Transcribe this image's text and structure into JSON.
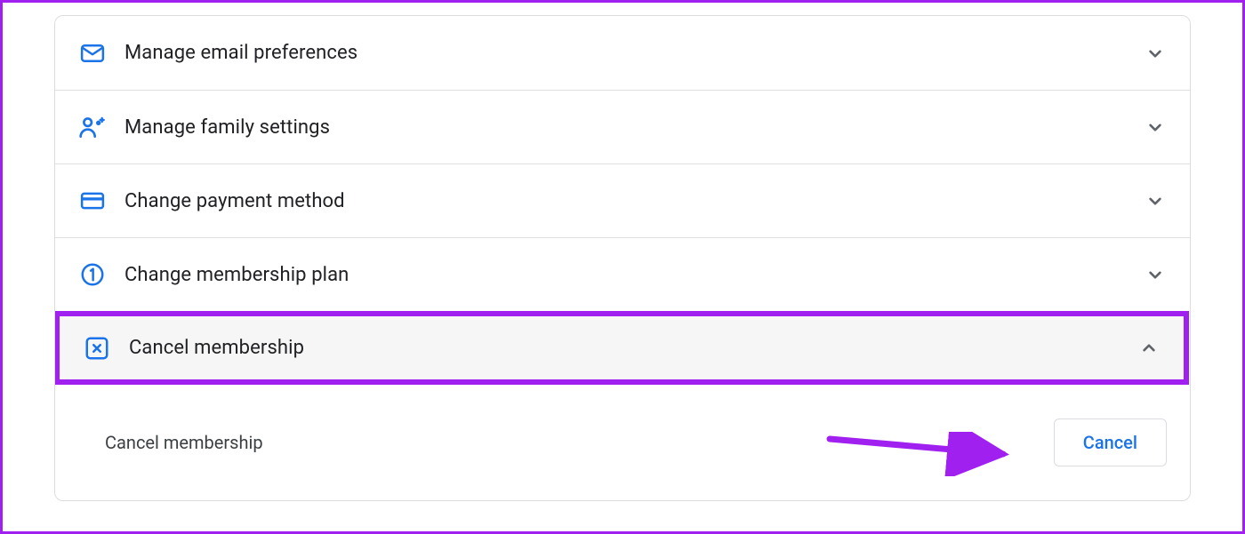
{
  "colors": {
    "accent": "#1a73e8",
    "annotation": "#a020f0",
    "chevron": "#5f6368"
  },
  "rows": [
    {
      "id": "email-prefs",
      "icon": "mail-icon",
      "label": "Manage email preferences",
      "expanded": false
    },
    {
      "id": "family",
      "icon": "family-icon",
      "label": "Manage family settings",
      "expanded": false
    },
    {
      "id": "payment",
      "icon": "credit-card-icon",
      "label": "Change payment method",
      "expanded": false
    },
    {
      "id": "plan",
      "icon": "circled-one-icon",
      "label": "Change membership plan",
      "expanded": false
    },
    {
      "id": "cancel",
      "icon": "cancel-box-icon",
      "label": "Cancel membership",
      "expanded": true,
      "highlighted": true
    }
  ],
  "detail": {
    "label": "Cancel membership",
    "button": "Cancel"
  }
}
